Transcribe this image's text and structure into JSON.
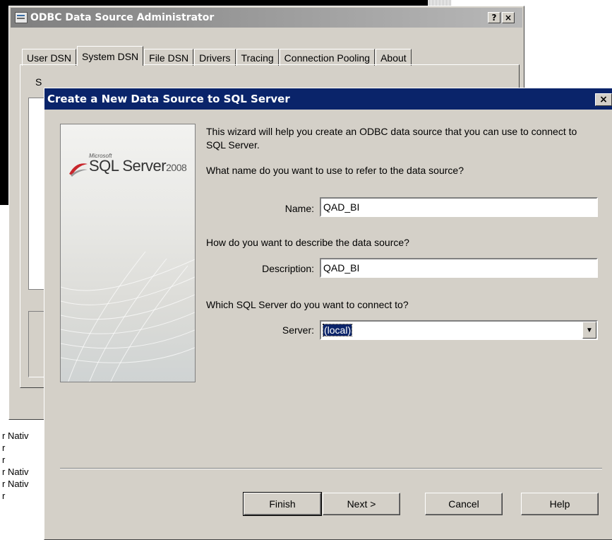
{
  "odbc_window": {
    "title": "ODBC Data Source Administrator",
    "help_button": "?",
    "close_button": "×",
    "tabs": [
      {
        "label": "User DSN"
      },
      {
        "label": "System DSN"
      },
      {
        "label": "File DSN"
      },
      {
        "label": "Drivers"
      },
      {
        "label": "Tracing"
      },
      {
        "label": "Connection Pooling"
      },
      {
        "label": "About"
      }
    ],
    "active_tab": "System DSN",
    "panel_label_partial": "S"
  },
  "background_list": {
    "items": [
      "r Nativ",
      "r",
      "r",
      "r Nativ",
      "r Nativ",
      "r"
    ]
  },
  "wizard": {
    "title": "Create a New Data Source to SQL Server",
    "close_button": "×",
    "logo": {
      "vendor": "Microsoft",
      "product": "SQL Server",
      "version": "2008"
    },
    "intro": "This wizard will help you create an ODBC data source that you can use to connect to SQL Server.",
    "q_name": "What name do you want to use to refer to the data source?",
    "name_label": "Name:",
    "name_value": "QAD_BI",
    "q_description": "How do you want to describe the data source?",
    "description_label": "Description:",
    "description_value": "QAD_BI",
    "q_server": "Which SQL Server do you want to connect to?",
    "server_label": "Server:",
    "server_value": "(local)",
    "buttons": {
      "finish": "Finish",
      "next": "Next >",
      "cancel": "Cancel",
      "help": "Help"
    }
  }
}
